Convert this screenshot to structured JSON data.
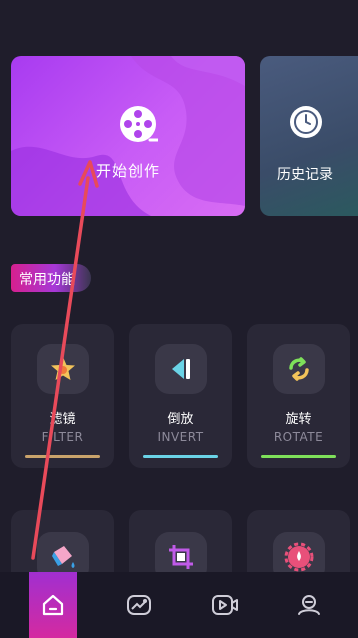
{
  "main": {
    "create_label": "开始创作",
    "history_label": "历史记录"
  },
  "section": {
    "title": "常用功能"
  },
  "features": [
    {
      "cn": "滤镜",
      "en": "FILTER",
      "icon": "filter-star-icon",
      "accent": "#c9a36b"
    },
    {
      "cn": "倒放",
      "en": "INVERT",
      "icon": "reverse-play-icon",
      "accent": "#6ad3e6"
    },
    {
      "cn": "旋转",
      "en": "ROTATE",
      "icon": "rotate-arrows-icon",
      "accent": "#7ee05a"
    }
  ],
  "features_row2_icons": [
    "paint-bucket-icon",
    "crop-icon",
    "settings-gear-icon"
  ],
  "tabbar": {
    "items": [
      "home-icon",
      "gallery-icon",
      "video-icon",
      "profile-icon"
    ],
    "active_index": 0
  },
  "colors": {
    "background": "#1f1d2b",
    "hero_gradient_start": "#a83bf0",
    "annotation_arrow": "#e84a5a"
  }
}
